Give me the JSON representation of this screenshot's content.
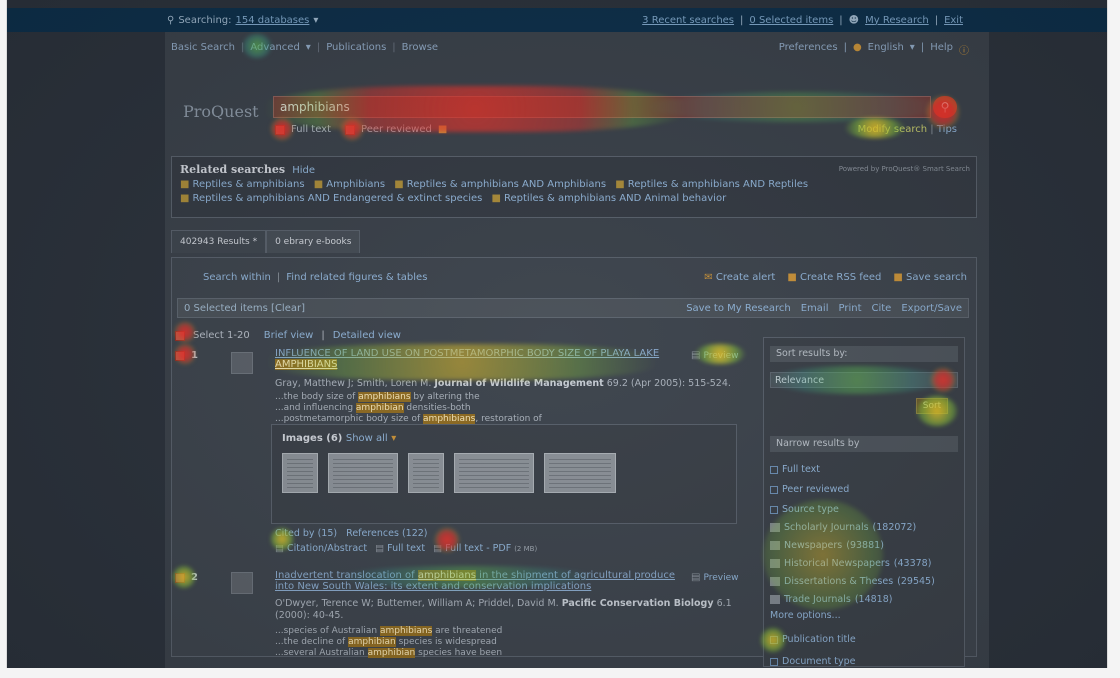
{
  "topbar": {
    "searching_prefix": "Searching:",
    "databases_link": "154 databases",
    "recent_searches": "3 Recent searches",
    "selected_items": "0 Selected items",
    "my_research": "My Research",
    "exit": "Exit"
  },
  "nav": {
    "basic_search": "Basic Search",
    "advanced": "Advanced",
    "publications": "Publications",
    "browse": "Browse",
    "preferences": "Preferences",
    "language": "English",
    "help": "Help"
  },
  "logo": "ProQuest",
  "search": {
    "query": "amphibians",
    "full_text": "Full text",
    "peer_reviewed": "Peer reviewed",
    "modify_search": "Modify search",
    "tips": "Tips"
  },
  "related": {
    "heading": "Related searches",
    "hide": "Hide",
    "powered_by": "Powered by ProQuest® Smart Search",
    "items_row1": [
      "Reptiles & amphibians",
      "Amphibians",
      "Reptiles & amphibians AND Amphibians",
      "Reptiles & amphibians AND Reptiles"
    ],
    "items_row2": [
      "Reptiles & amphibians AND Endangered & extinct species",
      "Reptiles & amphibians AND Animal behavior"
    ]
  },
  "tabs": {
    "results": "402943 Results *",
    "ebrary": "0 ebrary e-books"
  },
  "toolbar": {
    "search_within": "Search within",
    "find_related": "Find related figures & tables",
    "create_alert": "Create alert",
    "create_rss": "Create RSS feed",
    "save_search": "Save search",
    "selected": "0 Selected items [Clear]",
    "save_to_my_research": "Save to My Research",
    "email": "Email",
    "print": "Print",
    "cite": "Cite",
    "export_save": "Export/Save"
  },
  "view": {
    "select": "Select 1-20",
    "brief": "Brief view",
    "detailed": "Detailed view"
  },
  "results": [
    {
      "num": "1",
      "title_a": "INFLUENCE OF LAND USE ON POSTMETAMORPHIC BODY SIZE OF PLAYA LAKE",
      "title_b": "AMPHIBIANS",
      "preview": "Preview",
      "authors": "Gray, Matthew J; Smith, Loren M.",
      "journal": "Journal of Wildlife Management",
      "details": "69.2 (Apr 2005): 515-524.",
      "snippets": [
        [
          "...the body size of ",
          "amphibians",
          " by altering the"
        ],
        [
          "...and influencing ",
          "amphibian",
          " densities-both"
        ],
        [
          "...postmetamorphic body size of ",
          "amphibians",
          ", restoration of"
        ]
      ],
      "images_label": "Images (6)",
      "show_all": "Show all",
      "cited_by": "Cited by (15)",
      "references": "References (122)",
      "citation": "Citation/Abstract",
      "full_text": "Full text",
      "pdf": "Full text - PDF",
      "pdf_size": "(2 MB)"
    },
    {
      "num": "2",
      "title_pre": "Inadvertent translocation of ",
      "title_hl": "amphibians",
      "title_post": " in the shipment of agricultural produce into New South Wales: its extent and conservation implications",
      "preview": "Preview",
      "authors": "O'Dwyer, Terence W; Buttemer, William A; Priddel, David M.",
      "journal": "Pacific Conservation Biology",
      "details": "6.1 (2000): 40-45.",
      "snippets": [
        [
          "...species of Australian ",
          "amphibians",
          " are threatened"
        ],
        [
          "...the decline of ",
          "amphibian",
          " species is widespread"
        ],
        [
          "...several Australian ",
          "amphibian",
          " species have been"
        ]
      ]
    }
  ],
  "sidebar": {
    "sort_label": "Sort results by:",
    "sort_value": "Relevance",
    "sort_button": "Sort",
    "narrow": "Narrow results by",
    "full_text": "Full text",
    "peer_reviewed": "Peer reviewed",
    "source_type": "Source type",
    "sources": [
      {
        "label": "Scholarly Journals",
        "count": "(182072)"
      },
      {
        "label": "Newspapers",
        "count": "(93881)"
      },
      {
        "label": "Historical Newspapers",
        "count": "(43378)"
      },
      {
        "label": "Dissertations & Theses",
        "count": "(29545)"
      },
      {
        "label": "Trade Journals",
        "count": "(14818)"
      }
    ],
    "more_options": "More options...",
    "publication_title": "Publication title",
    "document_type": "Document type"
  },
  "colors": {
    "heat_hot": "#ed342c",
    "heat_warm": "#f0c828",
    "heat_cool": "#64c850",
    "topbar": "#0d2f4a"
  }
}
